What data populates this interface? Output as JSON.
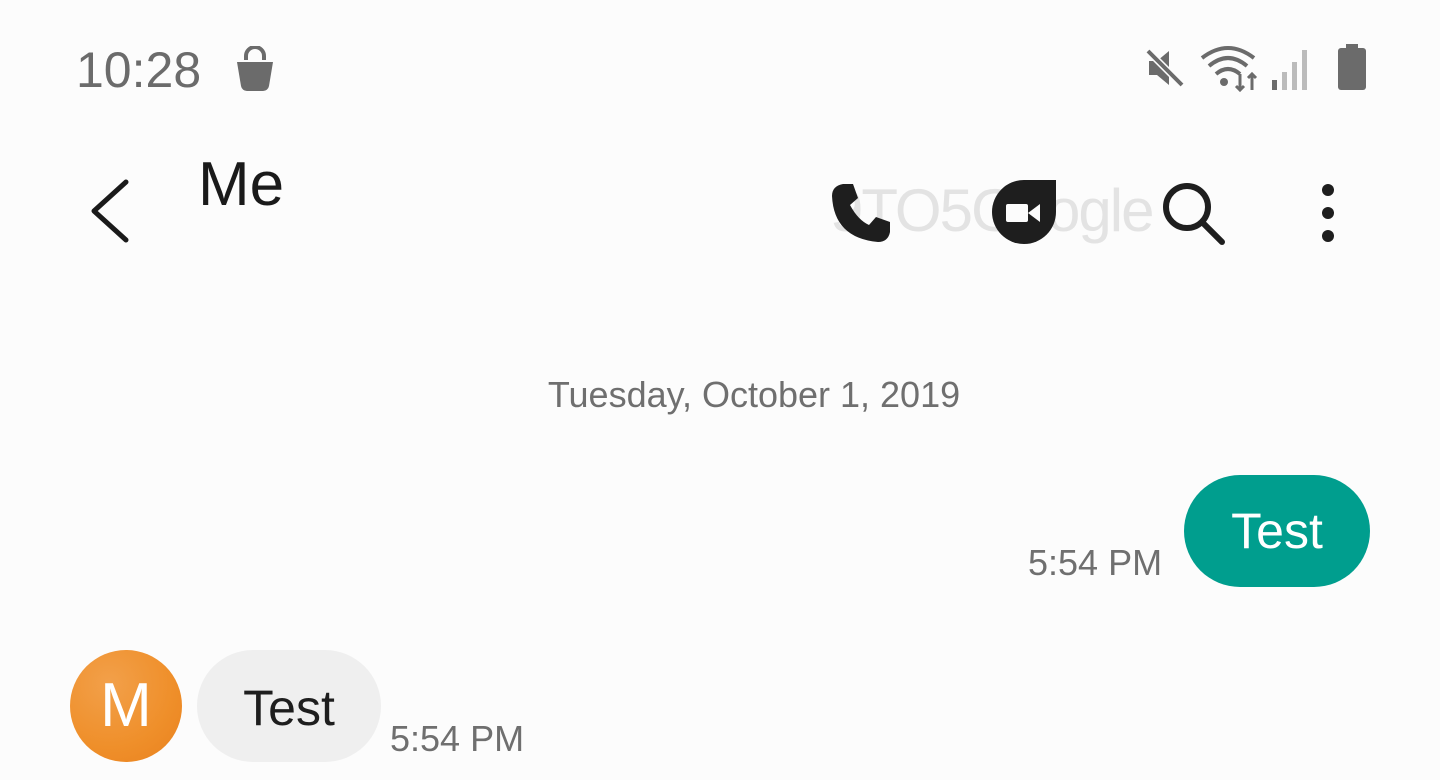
{
  "status_bar": {
    "time": "10:28",
    "icons": [
      "shopping-bag-icon",
      "mute-icon",
      "wifi-icon",
      "signal-icon",
      "battery-icon"
    ]
  },
  "app_bar": {
    "title": "Me",
    "icons": [
      "back-icon",
      "call-icon",
      "video-call-icon",
      "search-icon",
      "more-options-icon"
    ]
  },
  "watermark": "9TO5Google",
  "conversation": {
    "date_divider": "Tuesday, October 1, 2019",
    "messages": [
      {
        "direction": "sent",
        "text": "Test",
        "time": "5:54 PM"
      },
      {
        "direction": "received",
        "avatar_initial": "M",
        "text": "Test",
        "time": "5:54 PM"
      }
    ]
  },
  "colors": {
    "sent_bubble": "#009e8e",
    "received_bubble": "#efefef",
    "avatar": "#ef8f2a",
    "background": "#fcfcfc"
  }
}
